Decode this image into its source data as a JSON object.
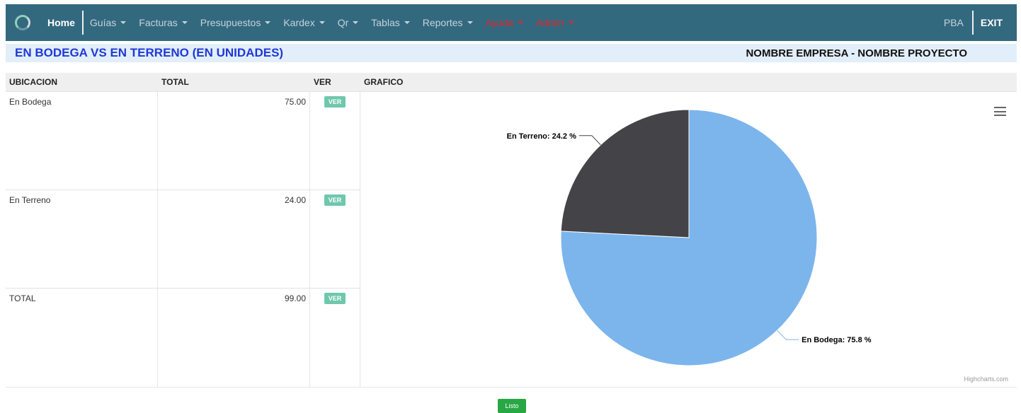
{
  "nav": {
    "home": "Home",
    "menus": [
      {
        "label": "Guías",
        "color": "#c4d3da"
      },
      {
        "label": "Facturas",
        "color": "#c4d3da"
      },
      {
        "label": "Presupuestos",
        "color": "#c4d3da"
      },
      {
        "label": "Kardex",
        "color": "#c4d3da"
      },
      {
        "label": "Qr",
        "color": "#c4d3da"
      },
      {
        "label": "Tablas",
        "color": "#c4d3da"
      },
      {
        "label": "Reportes",
        "color": "#c4d3da"
      },
      {
        "label": "Ayuda",
        "color": "#e0262a"
      },
      {
        "label": "Admin",
        "color": "#e0262a"
      }
    ],
    "user": "PBA",
    "exit": "EXIT",
    "background": "#33697f"
  },
  "header": {
    "title": "EN BODEGA VS EN TERRENO (EN UNIDADES)",
    "company": "NOMBRE EMPRESA - NOMBRE PROYECTO"
  },
  "table": {
    "columns": [
      "UBICACION",
      "TOTAL",
      "VER",
      "GRAFICO"
    ],
    "rows": [
      {
        "ubicacion": "En Bodega",
        "total": "75.00",
        "ver": "VER"
      },
      {
        "ubicacion": "En Terreno",
        "total": "24.00",
        "ver": "VER"
      },
      {
        "ubicacion": "TOTAL",
        "total": "99.00",
        "ver": "VER"
      }
    ]
  },
  "chart_data": {
    "type": "pie",
    "categories": [
      "En Bodega",
      "En Terreno"
    ],
    "values": [
      75.8,
      24.2
    ],
    "unit": "%",
    "colors": [
      "#7cb5ec",
      "#434348"
    ],
    "data_labels": [
      "En Bodega: 75.8 %",
      "En Terreno: 24.2 %"
    ],
    "credits": "Highcharts.com"
  },
  "footer": {
    "listo": "Listo"
  }
}
